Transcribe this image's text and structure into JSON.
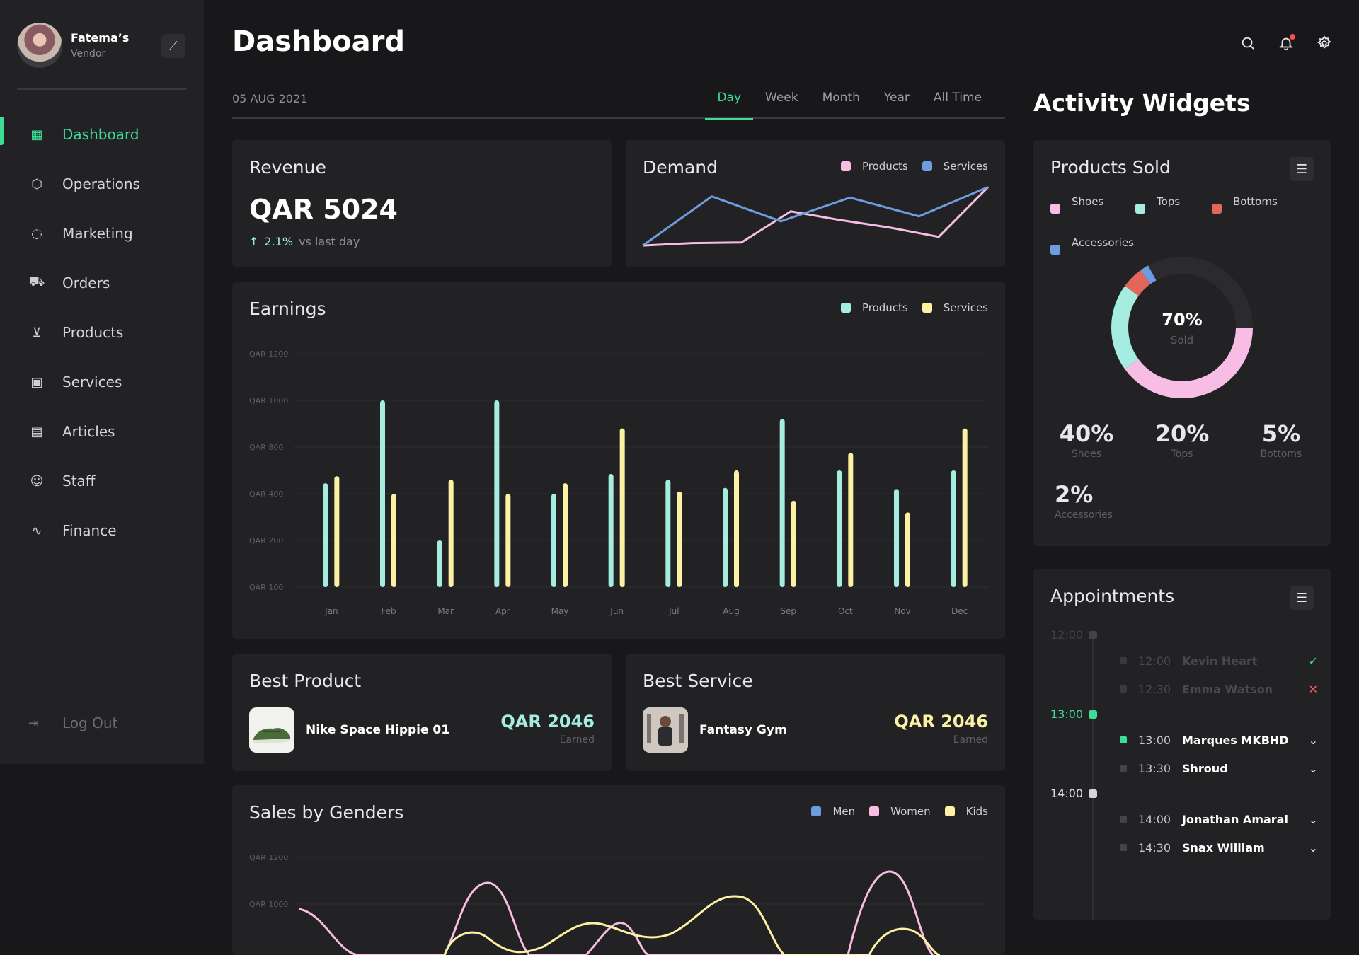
{
  "sidebar": {
    "profile": {
      "name": "Fatema’s",
      "role": "Vendor"
    },
    "items": [
      {
        "label": "Dashboard",
        "icon": "grid-icon"
      },
      {
        "label": "Operations",
        "icon": "box-icon"
      },
      {
        "label": "Marketing",
        "icon": "flame-icon"
      },
      {
        "label": "Orders",
        "icon": "truck-icon"
      },
      {
        "label": "Products",
        "icon": "cart-icon"
      },
      {
        "label": "Services",
        "icon": "briefcase-icon"
      },
      {
        "label": "Articles",
        "icon": "document-icon"
      },
      {
        "label": "Staff",
        "icon": "users-icon"
      },
      {
        "label": "Finance",
        "icon": "pulse-icon"
      }
    ],
    "logout": "Log Out"
  },
  "header": {
    "title": "Dashboard"
  },
  "datebar": {
    "date": "05 AUG 2021",
    "periods": [
      "Day",
      "Week",
      "Month",
      "Year",
      "All Time"
    ],
    "active_period": "Day"
  },
  "revenue": {
    "title": "Revenue",
    "value": "QAR 5024",
    "delta": "2.1%",
    "delta_text": "vs last day"
  },
  "colors": {
    "accent": "#3ddc97",
    "products_teal": "#a4ede0",
    "services_yellow": "#fdf2a4",
    "pink": "#f7bde4",
    "blue": "#6d9de0",
    "red": "#e0675a"
  },
  "best_product": {
    "title": "Best Product",
    "name": "Nike Space Hippie 01",
    "value": "QAR 2046",
    "sub": "Earned"
  },
  "best_service": {
    "title": "Best Service",
    "name": "Fantasy Gym",
    "value": "QAR 2046",
    "sub": "Earned"
  },
  "activity_widgets": {
    "title": "Activity Widgets"
  },
  "products_sold": {
    "title": "Products Sold",
    "legend": [
      "Shoes",
      "Tops",
      "Bottoms",
      "Accessories"
    ],
    "center_value": "70%",
    "center_label": "Sold",
    "stats": [
      {
        "value": "40%",
        "label": "Shoes"
      },
      {
        "value": "20%",
        "label": "Tops"
      },
      {
        "value": "5%",
        "label": "Bottoms"
      },
      {
        "value": "2%",
        "label": "Accessories"
      }
    ]
  },
  "appointments": {
    "title": "Appointments",
    "hours": [
      "12:00",
      "13:00",
      "14:00"
    ],
    "rows": [
      {
        "time": "12:00",
        "name": "Kevin Heart",
        "status": "✓"
      },
      {
        "time": "12:30",
        "name": "Emma Watson",
        "status": "✕"
      },
      {
        "time": "13:00",
        "name": "Marques MKBHD",
        "status": "⌄"
      },
      {
        "time": "13:30",
        "name": "Shroud",
        "status": "⌄"
      },
      {
        "time": "14:00",
        "name": "Jonathan Amaral",
        "status": "⌄"
      },
      {
        "time": "14:30",
        "name": "Snax William",
        "status": "⌄"
      }
    ]
  },
  "chart_data": [
    {
      "type": "line",
      "title": "Demand",
      "series": [
        {
          "name": "Products",
          "values": [
            1,
            5,
            6,
            56,
            42,
            30,
            15,
            95
          ]
        },
        {
          "name": "Services",
          "values": [
            1,
            80,
            40,
            78,
            48,
            95
          ]
        }
      ]
    },
    {
      "type": "bar",
      "title": "Earnings",
      "categories": [
        "Jan",
        "Feb",
        "Mar",
        "Apr",
        "May",
        "Jun",
        "Jul",
        "Aug",
        "Sep",
        "Oct",
        "Nov",
        "Dec"
      ],
      "y_ticks": [
        "QAR 1200",
        "QAR 1000",
        "QAR 800",
        "QAR 400",
        "QAR 200",
        "QAR 100"
      ],
      "series": [
        {
          "name": "Products",
          "values": [
            490,
            1000,
            200,
            1000,
            400,
            570,
            520,
            450,
            920,
            600,
            440,
            600
          ]
        },
        {
          "name": "Services",
          "values": [
            550,
            400,
            520,
            400,
            490,
            880,
            420,
            600,
            370,
            750,
            320,
            880
          ]
        }
      ]
    },
    {
      "type": "line",
      "title": "Sales by Genders",
      "y_ticks": [
        "QAR 1200",
        "QAR 1000"
      ],
      "series": [
        {
          "name": "Men",
          "values": []
        },
        {
          "name": "Women",
          "values": []
        },
        {
          "name": "Kids",
          "values": []
        }
      ]
    },
    {
      "type": "pie",
      "title": "Products Sold",
      "categories": [
        "Shoes",
        "Tops",
        "Bottoms",
        "Accessories"
      ],
      "values": [
        40,
        20,
        5,
        2
      ]
    }
  ]
}
